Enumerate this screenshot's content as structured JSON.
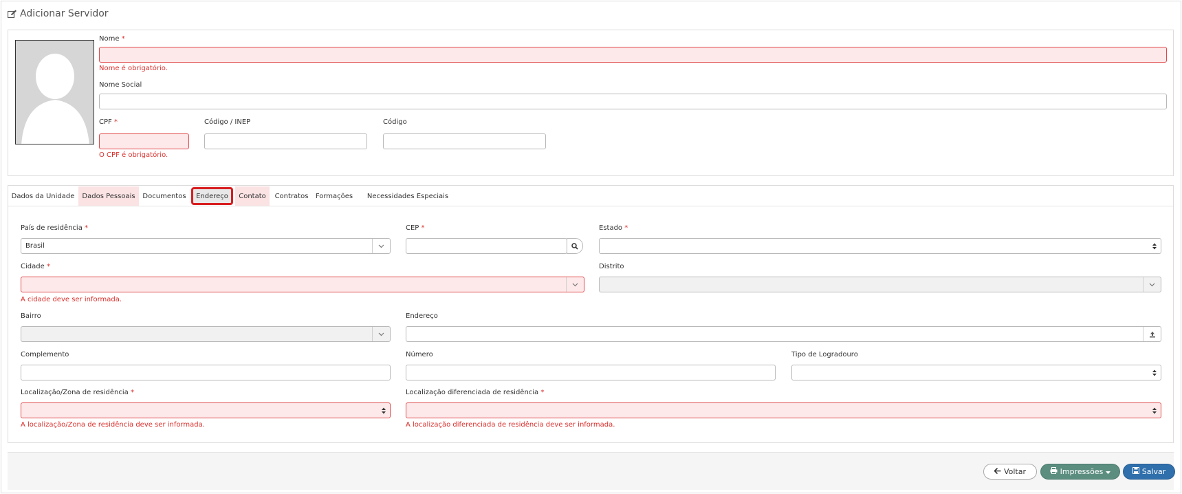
{
  "page": {
    "title": "Adicionar Servidor"
  },
  "form": {
    "nome": {
      "label": "Nome",
      "required_mark": "*",
      "value": "",
      "error": "Nome é obrigatório."
    },
    "nome_social": {
      "label": "Nome Social",
      "value": ""
    },
    "cpf": {
      "label": "CPF",
      "required_mark": "*",
      "value": "",
      "error": "O CPF é obrigatório."
    },
    "codigo_inep": {
      "label": "Código / INEP",
      "value": ""
    },
    "codigo": {
      "label": "Código",
      "value": ""
    }
  },
  "tabs": [
    {
      "label": "Dados da Unidade",
      "state": "normal"
    },
    {
      "label": "Dados Pessoais",
      "state": "error"
    },
    {
      "label": "Documentos",
      "state": "normal"
    },
    {
      "label": "Endereço",
      "state": "active"
    },
    {
      "label": "Contato",
      "state": "error"
    },
    {
      "label": "Contratos",
      "state": "normal"
    },
    {
      "label": "Formações",
      "state": "normal"
    },
    {
      "label": "Necessidades Especiais",
      "state": "normal"
    }
  ],
  "endereco": {
    "pais": {
      "label": "País de residência",
      "required_mark": "*",
      "value": "Brasil"
    },
    "cep": {
      "label": "CEP",
      "required_mark": "*",
      "value": ""
    },
    "estado": {
      "label": "Estado",
      "required_mark": "*",
      "value": ""
    },
    "cidade": {
      "label": "Cidade",
      "required_mark": "*",
      "value": "",
      "error": "A cidade deve ser informada."
    },
    "distrito": {
      "label": "Distrito",
      "value": ""
    },
    "bairro": {
      "label": "Bairro",
      "value": ""
    },
    "endereco": {
      "label": "Endereço",
      "value": ""
    },
    "complemento": {
      "label": "Complemento",
      "value": ""
    },
    "numero": {
      "label": "Número",
      "value": ""
    },
    "tipo_logradouro": {
      "label": "Tipo de Logradouro",
      "value": ""
    },
    "zona": {
      "label": "Localização/Zona de residência",
      "required_mark": "*",
      "value": "",
      "error": "A localização/Zona de residência deve ser informada."
    },
    "loc_diferenciada": {
      "label": "Localização diferenciada de residência",
      "required_mark": "*",
      "value": "",
      "error": "A localização diferenciada de residência deve ser informada."
    }
  },
  "footer": {
    "back_label": "Voltar",
    "print_label": "Impressões",
    "save_label": "Salvar"
  },
  "icons": {
    "title": "edit-icon",
    "search": "search-icon",
    "upload": "upload-icon",
    "back": "arrow-left-icon",
    "print": "print-icon",
    "save": "save-icon",
    "dropdown": "chevron-down-icon",
    "select": "sort-arrows-icon"
  },
  "colors": {
    "error": "#d9302c",
    "error_bg": "#fde9ea",
    "primary": "#2f6fab",
    "print": "#5c8e80"
  }
}
